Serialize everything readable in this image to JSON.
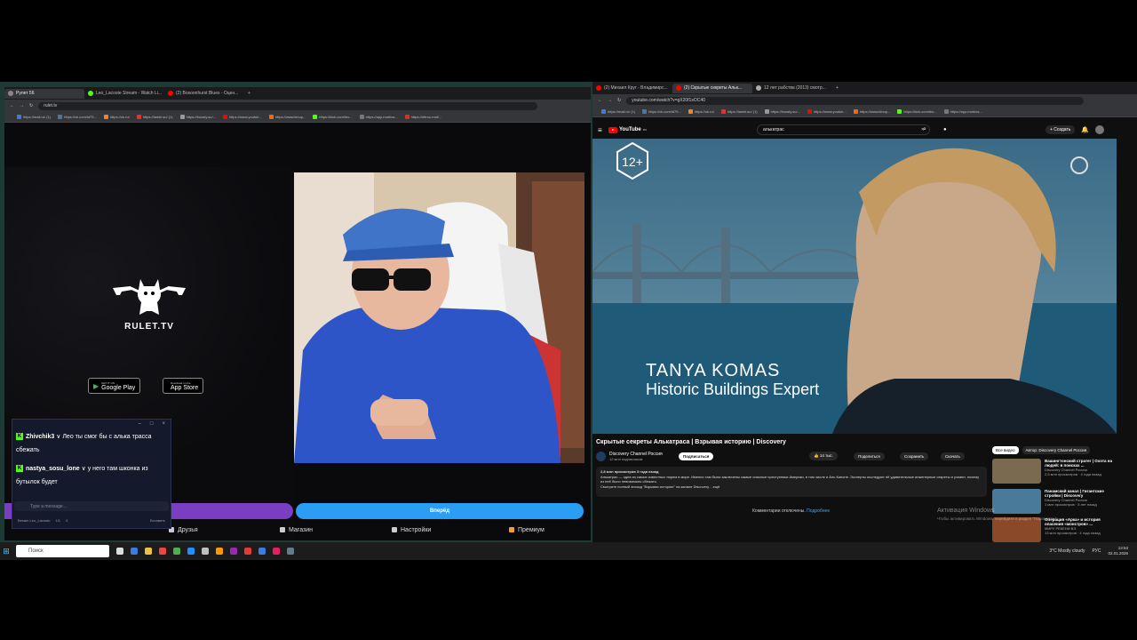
{
  "left_browser": {
    "tabs": [
      {
        "label": "Рулет 56",
        "color": "#888888",
        "active": true
      },
      {
        "label": "Leo_Lacoste Stream - Watch Li...",
        "color": "#53fc18",
        "active": false
      },
      {
        "label": "(2) Bosoonhurst Blues - Оцен...",
        "color": "#ff0000",
        "active": false
      }
    ],
    "url": "rulet.tv",
    "bookmarks": [
      {
        "label": "https://mail.ru/ (1)",
        "color": "#3c7be0"
      },
      {
        "label": "https://vk.com/id79...",
        "color": "#4a76a8"
      },
      {
        "label": "https://ok.ru/",
        "color": "#f58220"
      },
      {
        "label": "https://lamki.su/ (1)",
        "color": "#d33"
      },
      {
        "label": "https://boosty.su/...",
        "color": "#999"
      },
      {
        "label": "https://www.youtub...",
        "color": "#f00"
      },
      {
        "label": "https://www.kinop...",
        "color": "#f60"
      },
      {
        "label": "https://kick.com/leo...",
        "color": "#53fc18"
      },
      {
        "label": "https://app.mobios...",
        "color": "#777"
      },
      {
        "label": "https://drtrou.mail...",
        "color": "#c33"
      }
    ]
  },
  "rulet": {
    "logo_text": "RULET.TV",
    "google_play_small": "GET IT ON",
    "google_play_label": "Google Play",
    "app_store_small": "Download on the",
    "app_store_label": "App Store",
    "start_button": "Вперёд",
    "nav": [
      "Друзья",
      "Магазин",
      "Настройки",
      "Премиум"
    ]
  },
  "chat": {
    "controls": [
      "–",
      "□",
      "×"
    ],
    "messages": [
      {
        "user": "Zhivchik3",
        "text": "Лео ты смог бы с алька трасса сбежать"
      },
      {
        "user": "nastya_sosu_lone",
        "text": "у него там шконка из бутылок будет"
      }
    ],
    "input_placeholder": "Type a message...",
    "footer_user": "Besam Leo_Lacosto",
    "footer_count": "1/1",
    "footer_viewers": "3",
    "footer_link": "Вставить"
  },
  "right_browser": {
    "tabs": [
      {
        "label": "(2) Михаил Круг - Владимирс...",
        "color": "#ff0000",
        "active": false
      },
      {
        "label": "(2) Скрытые секреты Альк...",
        "color": "#ff0000",
        "active": true
      },
      {
        "label": "12 лет рабства (2013) смотр...",
        "color": "#aaaaaa",
        "active": false
      }
    ],
    "url": "youtube.com/watch?v=gX20f1sOC40",
    "bookmarks": [
      {
        "label": "https://mail.ru/ (1)",
        "color": "#3c7be0"
      },
      {
        "label": "https://vk.com/id79...",
        "color": "#4a76a8"
      },
      {
        "label": "https://ok.ru/",
        "color": "#f58220"
      },
      {
        "label": "https://lamki.su/ (1)",
        "color": "#d33"
      },
      {
        "label": "https://boosty.su/...",
        "color": "#999"
      },
      {
        "label": "https://www.youtub...",
        "color": "#f00"
      },
      {
        "label": "https://www.kinop...",
        "color": "#f60"
      },
      {
        "label": "https://kick.com/leo...",
        "color": "#53fc18"
      },
      {
        "label": "https://app.mobios...",
        "color": "#777"
      }
    ]
  },
  "youtube": {
    "logo": "YouTube",
    "logo_suffix": "RU",
    "search_query": "алькатрас",
    "create_label": "+ Создать",
    "video": {
      "rating": "12+",
      "lower_third_name": "TANYA KOMAS",
      "lower_third_title": "Historic Buildings Expert"
    },
    "title": "Скрытые секреты Алькатраса | Взрывая историю | Discovery",
    "channel": "Discovery Channel Россия",
    "subscribers": "12 млн подписчиков",
    "subscribe_label": "Подписаться",
    "likes": "14 тыс.",
    "share": "Поделиться",
    "save": "Сохранить",
    "download": "Скачать",
    "description_meta": "2,8 млн просмотров  3 года назад",
    "description": "Алькатрас — одна из самых известных тюрем в мире. Именно там были заключены самые опасные преступники Америки, в том числе и Аль Капоне. Эксперты исследуют её удивительные инженерные секреты и узнают, почему из неё было невозможно сбежать.",
    "description_more": "Смотрите полный эпизод \"Взрывая историю\" на канале Discovery ...ещё",
    "comments_off": "Комментарии отключены.",
    "comments_more": "Подробнее",
    "chips": [
      "Все видео",
      "Автор: Discovery Channel Россия"
    ],
    "recommendations": [
      {
        "title": "Вашингтонский стратег | Охота на людей: в поисках ...",
        "channel": "Discovery Channel Россия",
        "meta": "2,5 млн просмотров · 4 года назад",
        "color": "#7a6a50",
        "duration": "44:24"
      },
      {
        "title": "Панамский канал | Гигантские стройки | Discovery",
        "channel": "Discovery Channel Россия",
        "meta": "1 млн просмотров · 5 лет назад",
        "color": "#4a7a9a",
        "duration": "44:19"
      },
      {
        "title": "Операция «Арка» и история опасения «монстров» ...",
        "channel": "МИРУ РЕКЕНИ ВЭ",
        "meta": "13 млн просмотров · 4 года назад",
        "color": "#8a4a2a",
        "duration": ""
      }
    ],
    "activation_title": "Активация Windows",
    "activation_sub": "Чтобы активировать Windows, перейдите в раздел \"Параметры\"."
  },
  "taskbar": {
    "search_placeholder": "Поиск",
    "weather": "3°C  Mostly cloudy",
    "lang": "РУС",
    "time": "13:53",
    "date": "02.01.2026",
    "icon_colors": [
      "#ddd",
      "#3c7be0",
      "#f0c040",
      "#e44",
      "#4caf50",
      "#1e90ff",
      "#c0c0c0",
      "#ff9800",
      "#9c27b0",
      "#e53935",
      "#3c7be0",
      "#e91e63",
      "#607d8b"
    ]
  }
}
